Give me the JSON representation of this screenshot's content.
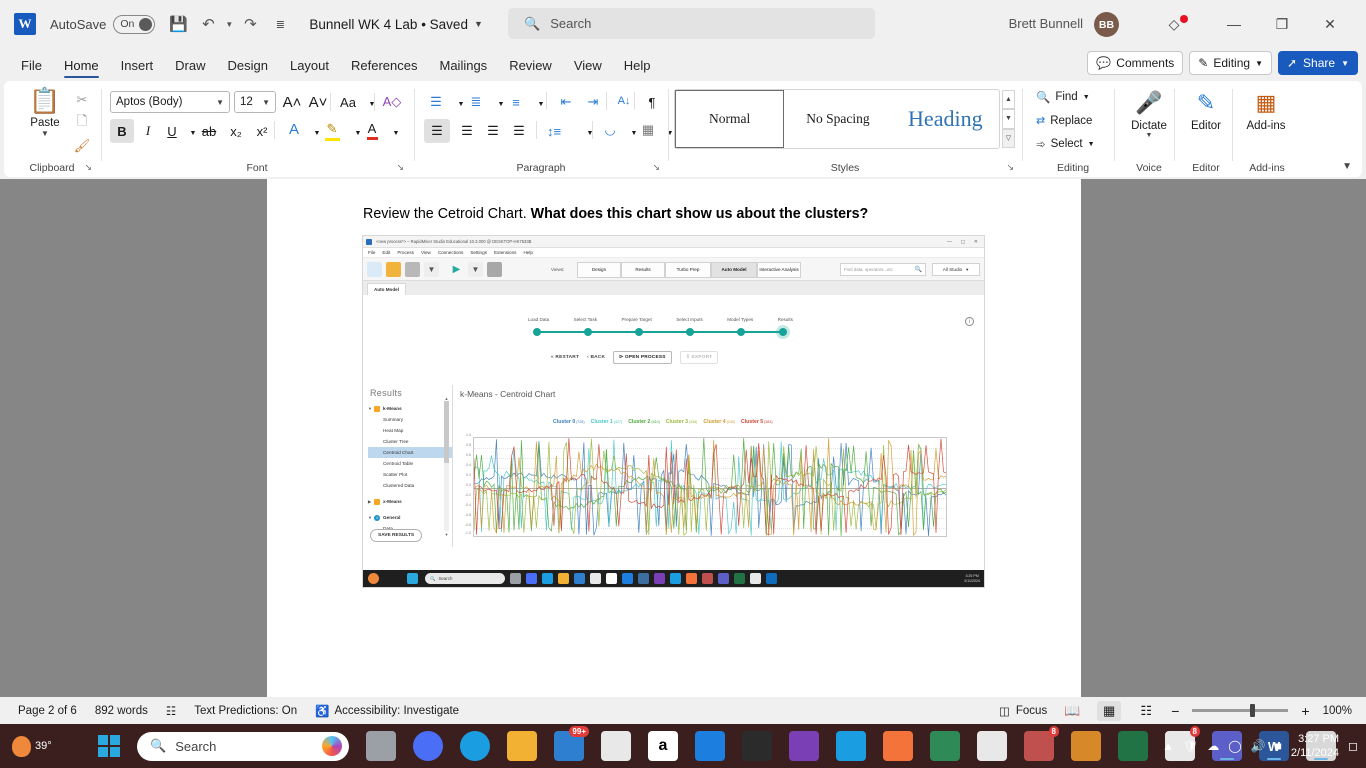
{
  "titlebar": {
    "app_logo": "word-logo",
    "autosave_label": "AutoSave",
    "autosave_state": "On",
    "doc_title": "Bunnell WK 4 Lab  •  Saved",
    "search_placeholder": "Search",
    "user_name": "Brett Bunnell",
    "user_initials": "BB",
    "buttons": {
      "minimize": "—",
      "restore": "❐",
      "close": "✕"
    }
  },
  "ribbon_tabs": {
    "items": [
      "File",
      "Home",
      "Insert",
      "Draw",
      "Design",
      "Layout",
      "References",
      "Mailings",
      "Review",
      "View",
      "Help"
    ],
    "active": "Home",
    "comments_label": "Comments",
    "editing_label": "Editing",
    "share_label": "Share"
  },
  "ribbon": {
    "clipboard": {
      "group_label": "Clipboard",
      "paste_label": "Paste",
      "cut_icon": "scissors-icon",
      "copy_icon": "copy-icon",
      "format_painter_icon": "format-painter-icon"
    },
    "font": {
      "group_label": "Font",
      "font_family": "Aptos (Body)",
      "font_size": "12",
      "grow_font": "A˄",
      "shrink_font": "A˅",
      "change_case": "Aa",
      "clear_formatting": "A◇",
      "bold": "B",
      "italic": "I",
      "underline": "U",
      "strikethrough": "ab",
      "subscript": "x₂",
      "superscript": "x²",
      "text_effects": "A",
      "highlight": "✎",
      "font_color": "A"
    },
    "paragraph": {
      "group_label": "Paragraph",
      "bullets": "bullets-icon",
      "numbering": "numbering-icon",
      "multilevel": "multilevel-list-icon",
      "decrease_indent": "decrease-indent-icon",
      "increase_indent": "increase-indent-icon",
      "sort": "sort-icon",
      "show_marks": "¶",
      "align_left": "align-left-icon",
      "align_center": "align-center-icon",
      "align_right": "align-right-icon",
      "justify": "justify-icon",
      "line_spacing": "line-spacing-icon",
      "shading": "shading-icon",
      "borders": "borders-icon"
    },
    "styles": {
      "group_label": "Styles",
      "items": [
        "Normal",
        "No Spacing",
        "Heading"
      ],
      "active": "Normal"
    },
    "editing": {
      "group_label": "Editing",
      "find": "Find",
      "replace": "Replace",
      "select": "Select"
    },
    "voice": {
      "group_label": "Voice",
      "dictate": "Dictate"
    },
    "editor_group": {
      "group_label": "Editor",
      "editor": "Editor"
    },
    "addins": {
      "group_label": "Add-ins",
      "addins": "Add-ins"
    }
  },
  "document": {
    "line1_plain": "Review the Cetroid Chart. ",
    "line1_bold": "What does this chart show us about the clusters?"
  },
  "embedded_screenshot": {
    "window_title": "<new process*> – RapidMiner Studio Educational 10.3.000 @ DESKTOP-HK7533B",
    "menus": [
      "File",
      "Edit",
      "Process",
      "View",
      "Connections",
      "Settings",
      "Extensions",
      "Help"
    ],
    "views_label": "Views:",
    "view_tabs": [
      "Design",
      "Results",
      "Turbo Prep",
      "Auto Model",
      "Interactive Analysis"
    ],
    "active_view_tab": "Auto Model",
    "find_placeholder": "Find data, operators...etc",
    "studio_dropdown": "All Studio",
    "tab_label": "Auto Model",
    "steps": [
      "Load Data",
      "Select Task",
      "Prepare Target",
      "Select Inputs",
      "Model Types",
      "Results"
    ],
    "step_buttons": [
      "RESTART",
      "BACK",
      "OPEN PROCESS",
      "EXPORT"
    ],
    "results_panel": {
      "title": "Results",
      "nodes": [
        {
          "label": "k-Means",
          "type": "root",
          "expanded": true
        },
        {
          "label": "Summary",
          "type": "leaf"
        },
        {
          "label": "Heat Map",
          "type": "leaf"
        },
        {
          "label": "Cluster Tree",
          "type": "leaf"
        },
        {
          "label": "Centroid Chart",
          "type": "leaf",
          "selected": true
        },
        {
          "label": "Centroid Table",
          "type": "leaf"
        },
        {
          "label": "Scatter Plot",
          "type": "leaf"
        },
        {
          "label": "Clustered Data",
          "type": "leaf"
        },
        {
          "label": "x-Means",
          "type": "root",
          "expanded": false
        },
        {
          "label": "General",
          "type": "info",
          "expanded": true
        },
        {
          "label": "Data",
          "type": "leaf"
        }
      ],
      "save_button": "SAVE RESULTS"
    },
    "taskbar_time": "3:25 PM",
    "taskbar_date": "2/11/2024"
  },
  "chart_data": {
    "type": "line",
    "title": "k-Means - Centroid Chart",
    "xlabel": "",
    "ylabel": "",
    "ylim": [
      -1.0,
      1.0
    ],
    "yticks": [
      "1.0",
      "0.8",
      "0.6",
      "0.4",
      "0.2",
      "0.0",
      "-0.2",
      "-0.4",
      "-0.6",
      "-0.8",
      "-1.0"
    ],
    "grid": true,
    "legend_position": "top",
    "series": [
      {
        "name": "Cluster 0",
        "count": "(726)",
        "color": "#3b7dbd"
      },
      {
        "name": "Cluster 1",
        "count": "(427)",
        "color": "#49c5c5"
      },
      {
        "name": "Cluster 2",
        "count": "(810)",
        "color": "#4aa93a"
      },
      {
        "name": "Cluster 3",
        "count": "(438)",
        "color": "#9ab93a"
      },
      {
        "name": "Cluster 4",
        "count": "(245)",
        "color": "#cf9a2c"
      },
      {
        "name": "Cluster 5",
        "count": "(583)",
        "color": "#cf4231"
      }
    ]
  },
  "statusbar": {
    "page": "Page 2 of 6",
    "words": "892 words",
    "proofing_icon": "proofing-icon",
    "text_predictions": "Text Predictions: On",
    "accessibility": "Accessibility: Investigate",
    "focus": "Focus",
    "view_read": "read-mode-icon",
    "view_print": "print-layout-icon",
    "view_web": "web-layout-icon",
    "zoom_out": "−",
    "zoom_in": "+",
    "zoom_level": "100%"
  },
  "taskbar": {
    "weather_temp": "39°",
    "search_placeholder": "Search",
    "mail_badge": "99+",
    "store_badge": "8",
    "time": "3:27 PM",
    "date": "2/11/2024",
    "apps": [
      {
        "name": "task-view",
        "color": "#9aa0a6"
      },
      {
        "name": "zoom",
        "color": "#4a6ef5"
      },
      {
        "name": "edge",
        "color": "#1b9de2"
      },
      {
        "name": "file-explorer",
        "color": "#f2b133"
      },
      {
        "name": "mail",
        "color": "#2f7fd0"
      },
      {
        "name": "microsoft-store",
        "color": "#e8e8e8"
      },
      {
        "name": "amazon",
        "color": "#ffffff"
      },
      {
        "name": "dropbox",
        "color": "#1c7fe0"
      },
      {
        "name": "python",
        "color": "#3b6fa0"
      },
      {
        "name": "chrome-canary",
        "color": "#f4b400"
      },
      {
        "name": "vlc",
        "color": "#e8720c"
      },
      {
        "name": "onedrive",
        "color": "#1b9de2"
      },
      {
        "name": "rapidminer",
        "color": "#f4733a"
      },
      {
        "name": "powerpoint",
        "color": "#c0504d"
      },
      {
        "name": "teams",
        "color": "#5b5fc7"
      },
      {
        "name": "excel",
        "color": "#217346"
      },
      {
        "name": "chrome",
        "color": "#e8e8e8"
      },
      {
        "name": "outlook",
        "color": "#0f6cbd"
      },
      {
        "name": "word",
        "color": "#2b579a"
      },
      {
        "name": "snip",
        "color": "#d8d8d8"
      }
    ]
  }
}
